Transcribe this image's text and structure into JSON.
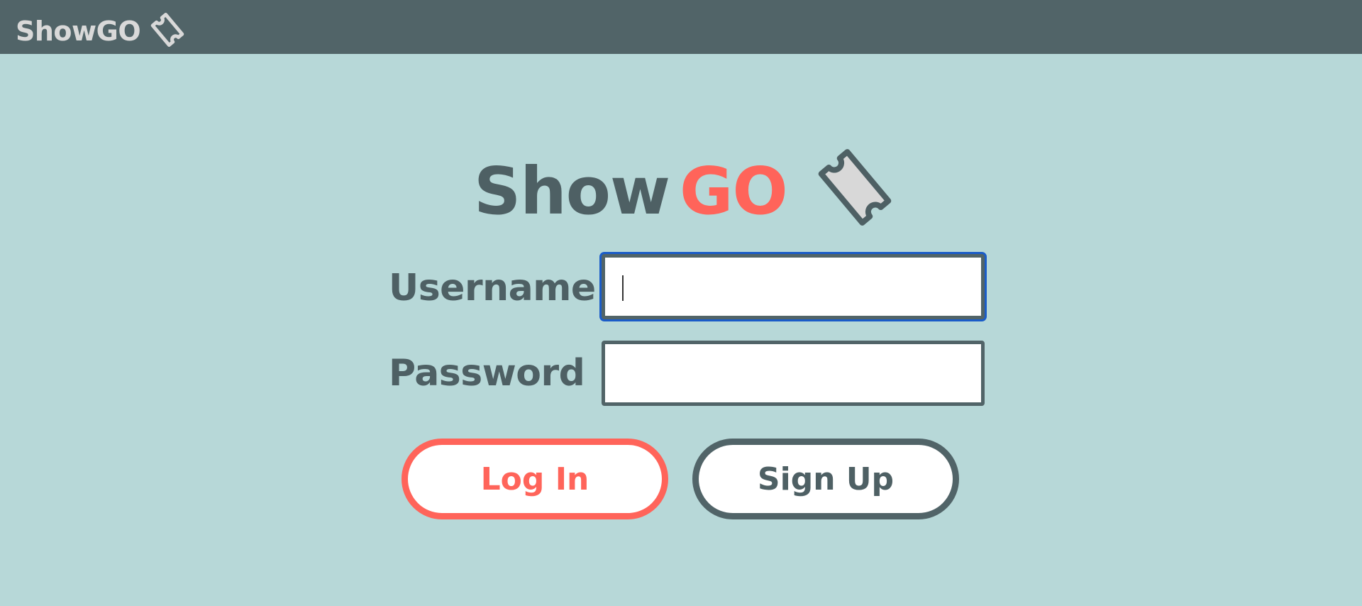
{
  "topbar": {
    "brand": "ShowGO",
    "ticket_icon": "ticket-icon"
  },
  "hero": {
    "title_part1": "Show",
    "title_part2": "GO",
    "ticket_icon": "ticket-icon"
  },
  "form": {
    "username_label": "Username",
    "username_value": "",
    "password_label": "Password",
    "password_value": ""
  },
  "actions": {
    "login_label": "Log In",
    "signup_label": "Sign Up"
  },
  "colors": {
    "topbar": "#516468",
    "background": "#b7d8d8",
    "primary_text": "#4e6064",
    "accent": "#ff645a",
    "focus_ring": "#1a5cc8"
  }
}
